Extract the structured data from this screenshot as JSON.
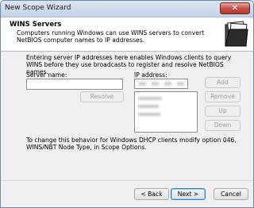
{
  "window": {
    "title": "New Scope Wizard",
    "close_glyph": "✕"
  },
  "header": {
    "title": "WINS Servers",
    "description": "Computers running Windows can use WINS servers to convert NetBIOS computer names to IP addresses.",
    "icon": "wizard-folder-icon"
  },
  "body": {
    "intro": "Entering server IP addresses here enables Windows clients to query WINS before they use broadcasts to register and resolve NetBIOS names.",
    "server_name_label": "Server name:",
    "server_name_value": "",
    "ip_address_label": "IP address:",
    "resolve_button": "Resolve",
    "add_button": "Add",
    "remove_button": "Remove",
    "up_button": "Up",
    "down_button": "Down",
    "note": "To change this behavior for Windows DHCP clients modify option 046, WINS/NBT Node Type, in Scope Options."
  },
  "footer": {
    "back_button": "< Back",
    "next_button": "Next >",
    "cancel_button": "Cancel"
  }
}
